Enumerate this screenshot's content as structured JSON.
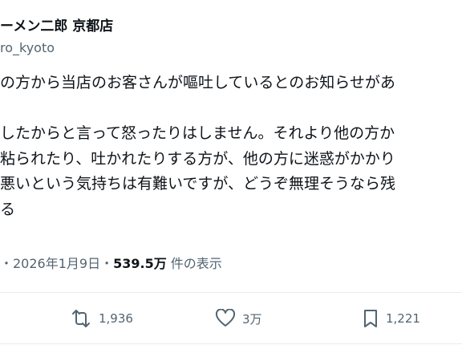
{
  "header": {
    "display_name": "ーメン二郎 京都店",
    "handle": "ro_kyoto"
  },
  "post": {
    "lines": [
      "の方から当店のお客さんが嘔吐しているとのお知らせがあ",
      "",
      "したからと言って怒ったりはしません。それより他の方か",
      "粘られたり、吐かれたりする方が、他の方に迷惑がかかり",
      "悪いという気持ちは有難いですが、どうぞ無理そうなら残",
      "る"
    ]
  },
  "meta": {
    "prefix": "・2026年1月9日・",
    "views_count": "539.5万",
    "views_suffix": " 件の表示"
  },
  "actions": {
    "retweets": "1,936",
    "likes": "3万",
    "bookmarks": "1,221"
  }
}
